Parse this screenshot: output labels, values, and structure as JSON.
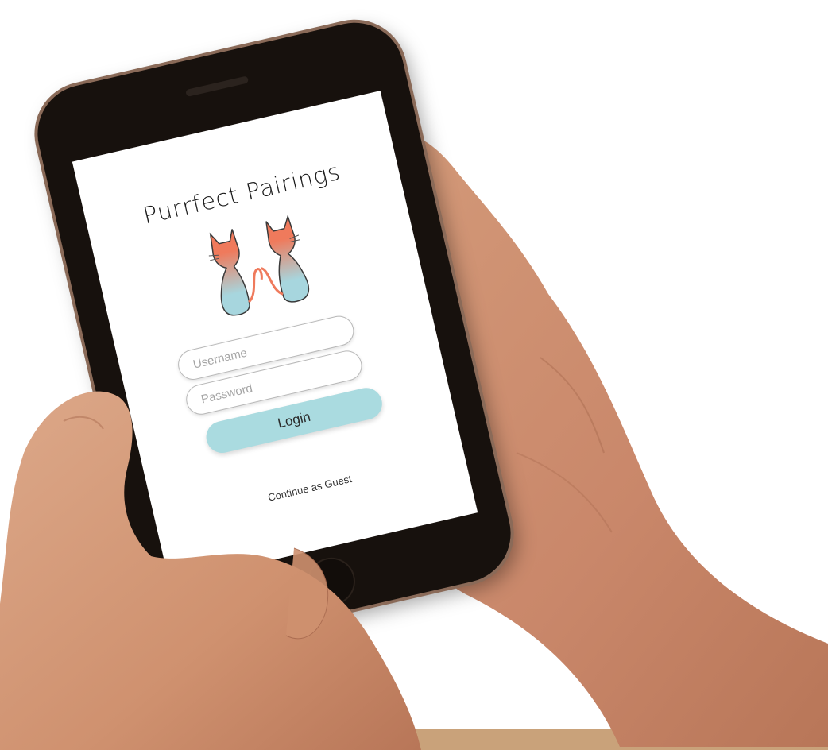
{
  "app": {
    "title": "Purrfect Pairings",
    "logo_icon": "cats-heart-icon"
  },
  "login_form": {
    "username_placeholder": "Username",
    "password_placeholder": "Password",
    "login_label": "Login",
    "guest_label": "Continue as Guest"
  },
  "colors": {
    "accent_button": "#aadbe0",
    "cat_top": "#ef7a5c",
    "cat_bottom": "#a7d6de",
    "bottom_bar": "#c9a27a"
  }
}
